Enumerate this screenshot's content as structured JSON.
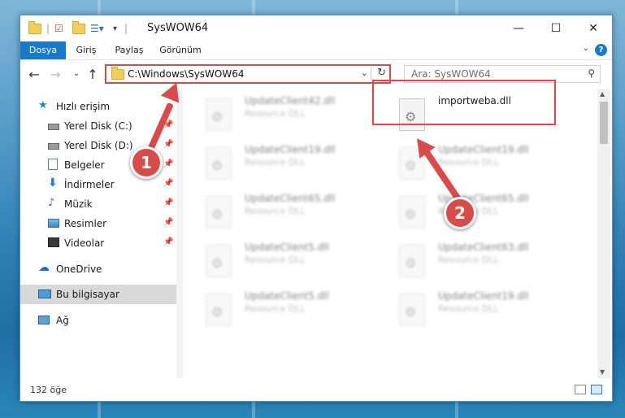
{
  "window": {
    "title": "SysWOW64",
    "controls": {
      "minimize": "—",
      "maximize": "☐",
      "close": "✕"
    }
  },
  "ribbon": {
    "tabs": [
      "Dosya",
      "Giriş",
      "Paylaş",
      "Görünüm"
    ],
    "help": "?"
  },
  "address_bar": {
    "path": "C:\\Windows\\SysWOW64"
  },
  "search": {
    "placeholder": "Ara: SysWOW64"
  },
  "sidebar": {
    "items": [
      {
        "label": "Hızlı erişim",
        "icon": "star-icon"
      },
      {
        "label": "Yerel Disk (C:)",
        "icon": "drive-icon"
      },
      {
        "label": "Yerel Disk (D:)",
        "icon": "drive-icon"
      },
      {
        "label": "Belgeler",
        "icon": "documents-icon"
      },
      {
        "label": "İndirmeler",
        "icon": "download-icon"
      },
      {
        "label": "Müzik",
        "icon": "music-icon"
      },
      {
        "label": "Resimler",
        "icon": "pictures-icon"
      },
      {
        "label": "Videolar",
        "icon": "video-icon"
      },
      {
        "label": "OneDrive",
        "icon": "cloud-icon"
      },
      {
        "label": "Bu bilgisayar",
        "icon": "computer-icon"
      },
      {
        "label": "Ağ",
        "icon": "network-icon"
      }
    ]
  },
  "files": {
    "left_column": [
      {
        "name": "UpdateClient42.dll",
        "desc": "Resource DLL"
      },
      {
        "name": "UpdateClient19.dll",
        "desc": "Resource DLL"
      },
      {
        "name": "UpdateClient65.dll",
        "desc": "Resource DLL"
      },
      {
        "name": "UpdateClient5.dll",
        "desc": "Resource DLL"
      },
      {
        "name": "UpdateClient5.dll",
        "desc": "Resource DLL"
      }
    ],
    "right_column": [
      {
        "name": "importweba.dll",
        "desc": ""
      },
      {
        "name": "UpdateClient19.dll",
        "desc": "Resource DLL"
      },
      {
        "name": "UpdateClient65.dll",
        "desc": "Resource DLL"
      },
      {
        "name": "UpdateClient63.dll",
        "desc": "Resource DLL"
      },
      {
        "name": "UpdateClient19.dll",
        "desc": "Resource DLL"
      }
    ]
  },
  "status": {
    "item_count": "132 öğe"
  },
  "annotations": {
    "badge_1": "1",
    "badge_2": "2",
    "color": "#d94a4a"
  }
}
